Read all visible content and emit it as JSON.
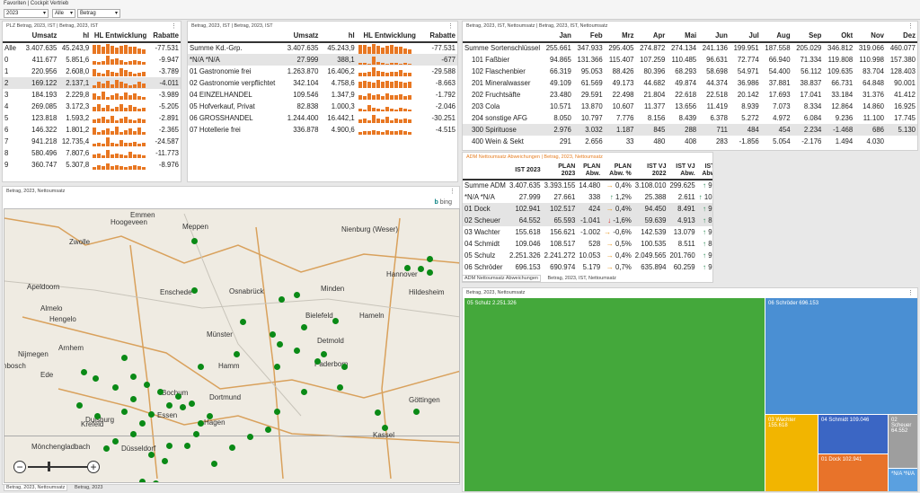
{
  "topbar": {
    "breadcrumb": "Favoriten | Cockpit Vertrieb",
    "filter_year": "2023",
    "filter_all": "Alle",
    "filter_measure": "Betrag"
  },
  "plz": {
    "title": "PLZ Betrag, 2023, IST | Betrag, 2023, IST",
    "headers": [
      "Umsatz",
      "hl",
      "HL Entwicklung",
      "Rabatte"
    ],
    "rows": [
      {
        "label": "Alle",
        "umsatz": "3.407.635",
        "hl": "45.243,9",
        "rabatte": "-77.531",
        "bars": [
          90,
          85,
          70,
          95,
          80,
          60,
          75,
          88,
          65,
          72,
          50,
          40
        ]
      },
      {
        "label": "0",
        "umsatz": "411.677",
        "hl": "5.851,6",
        "rabatte": "-9.947",
        "bars": [
          40,
          30,
          35,
          90,
          55,
          60,
          45,
          30,
          40,
          50,
          35,
          30
        ]
      },
      {
        "label": "1",
        "umsatz": "220.956",
        "hl": "2.608,0",
        "rabatte": "-3.789",
        "bars": [
          70,
          40,
          30,
          60,
          50,
          40,
          80,
          60,
          45,
          30,
          40,
          50
        ]
      },
      {
        "label": "2",
        "umsatz": "169.122",
        "hl": "2.137,1",
        "rabatte": "-4.011",
        "bars": [
          30,
          60,
          50,
          70,
          40,
          80,
          60,
          50,
          30,
          40,
          60,
          50
        ]
      },
      {
        "label": "3",
        "umsatz": "184.193",
        "hl": "2.229,8",
        "rabatte": "-3.989",
        "bars": [
          60,
          40,
          80,
          30,
          50,
          60,
          40,
          70,
          50,
          60,
          40,
          30
        ]
      },
      {
        "label": "4",
        "umsatz": "269.085",
        "hl": "3.172,3",
        "rabatte": "-5.205",
        "bars": [
          50,
          70,
          40,
          60,
          30,
          50,
          70,
          40,
          60,
          50,
          30,
          40
        ]
      },
      {
        "label": "5",
        "umsatz": "123.818",
        "hl": "1.593,2",
        "rabatte": "-2.891",
        "bars": [
          40,
          50,
          60,
          40,
          70,
          30,
          50,
          60,
          40,
          30,
          50,
          40
        ]
      },
      {
        "label": "6",
        "umsatz": "146.322",
        "hl": "1.801,2",
        "rabatte": "-2.365",
        "bars": [
          70,
          30,
          50,
          60,
          40,
          80,
          30,
          50,
          60,
          40,
          70,
          30
        ]
      },
      {
        "label": "7",
        "umsatz": "941.218",
        "hl": "12.735,4",
        "rabatte": "-24.587",
        "bars": [
          30,
          40,
          30,
          90,
          40,
          30,
          60,
          35,
          40,
          45,
          30,
          40
        ]
      },
      {
        "label": "8",
        "umsatz": "580.496",
        "hl": "7.807,6",
        "rabatte": "-11.773",
        "bars": [
          40,
          50,
          30,
          80,
          40,
          50,
          40,
          30,
          60,
          40,
          40,
          30
        ]
      },
      {
        "label": "9",
        "umsatz": "360.747",
        "hl": "5.307,8",
        "rabatte": "-8.976",
        "bars": [
          30,
          50,
          40,
          60,
          40,
          50,
          40,
          30,
          40,
          50,
          40,
          30
        ]
      }
    ]
  },
  "kd": {
    "title": "Betrag, 2023, IST | Betrag, 2023, IST",
    "headers": [
      "Umsatz",
      "hl",
      "HL Entwicklung",
      "Rabatte"
    ],
    "rows": [
      {
        "label": "Summe Kd.-Grp.",
        "umsatz": "3.407.635",
        "hl": "45.243,9",
        "rabatte": "-77.531",
        "bars": [
          90,
          85,
          70,
          95,
          80,
          60,
          75,
          88,
          65,
          72,
          50,
          40
        ]
      },
      {
        "label": "*N/A *N/A",
        "umsatz": "27.999",
        "hl": "388,1",
        "rabatte": "-677",
        "bars": [
          20,
          15,
          10,
          80,
          25,
          15,
          10,
          20,
          15,
          10,
          15,
          10
        ],
        "hl_row": true
      },
      {
        "label": "01 Gastronomie frei",
        "umsatz": "1.263.870",
        "hl": "16.406,2",
        "rabatte": "-29.588",
        "bars": [
          40,
          35,
          50,
          90,
          55,
          45,
          40,
          50,
          45,
          60,
          40,
          35
        ]
      },
      {
        "label": "02 Gastronomie verpflichtet",
        "umsatz": "342.104",
        "hl": "4.758,6",
        "rabatte": "-8.663",
        "bars": [
          60,
          70,
          65,
          55,
          80,
          60,
          70,
          65,
          75,
          60,
          55,
          60
        ]
      },
      {
        "label": "04 EINZELHANDEL",
        "umsatz": "109.546",
        "hl": "1.347,9",
        "rabatte": "-1.792",
        "bars": [
          50,
          40,
          60,
          45,
          55,
          40,
          60,
          50,
          45,
          55,
          40,
          50
        ]
      },
      {
        "label": "05 Hofverkauf, Privat",
        "umsatz": "82.838",
        "hl": "1.000,3",
        "rabatte": "-2.046",
        "bars": [
          30,
          20,
          60,
          40,
          30,
          20,
          50,
          30,
          20,
          40,
          30,
          20
        ]
      },
      {
        "label": "06 GROSSHANDEL",
        "umsatz": "1.244.400",
        "hl": "16.442,1",
        "rabatte": "-30.251",
        "bars": [
          40,
          50,
          30,
          80,
          50,
          40,
          60,
          30,
          50,
          40,
          50,
          40
        ]
      },
      {
        "label": "07 Hotellerie frei",
        "umsatz": "336.878",
        "hl": "4.900,6",
        "rabatte": "-4.515",
        "bars": [
          30,
          40,
          35,
          50,
          40,
          30,
          45,
          35,
          40,
          50,
          35,
          30
        ]
      }
    ]
  },
  "sorten": {
    "title": "Betrag, 2023, IST, Nettoumsatz | Betrag, 2023, IST, Nettoumsatz",
    "months": [
      "Jan",
      "Feb",
      "Mrz",
      "Apr",
      "Mai",
      "Jun",
      "Jul",
      "Aug",
      "Sep",
      "Okt",
      "Nov",
      "Dez"
    ],
    "rows": [
      {
        "label": "Summe Sortenschlüssel",
        "vals": [
          "255.661",
          "347.933",
          "295.405",
          "274.872",
          "274.134",
          "241.136",
          "199.951",
          "187.558",
          "205.029",
          "346.812",
          "319.066",
          "460.077"
        ]
      },
      {
        "label": "101 Faßbier",
        "vals": [
          "94.865",
          "131.366",
          "115.407",
          "107.259",
          "110.485",
          "96.631",
          "72.774",
          "66.940",
          "71.334",
          "119.808",
          "110.998",
          "157.380"
        ]
      },
      {
        "label": "102 Flaschenbier",
        "vals": [
          "66.319",
          "95.053",
          "88.426",
          "80.396",
          "68.293",
          "58.698",
          "54.971",
          "54.400",
          "56.112",
          "109.635",
          "83.704",
          "128.403"
        ]
      },
      {
        "label": "201 Mineralwasser",
        "vals": [
          "49.109",
          "61.569",
          "49.173",
          "44.682",
          "49.874",
          "44.374",
          "36.986",
          "37.881",
          "38.837",
          "66.731",
          "64.848",
          "90.001"
        ]
      },
      {
        "label": "202 Fruchtsäfte",
        "vals": [
          "23.480",
          "29.591",
          "22.498",
          "21.804",
          "22.618",
          "22.518",
          "20.142",
          "17.693",
          "17.041",
          "33.184",
          "31.376",
          "41.412"
        ]
      },
      {
        "label": "203 Cola",
        "vals": [
          "10.571",
          "13.870",
          "10.607",
          "11.377",
          "13.656",
          "11.419",
          "8.939",
          "7.073",
          "8.334",
          "12.864",
          "14.860",
          "16.925"
        ]
      },
      {
        "label": "204 sonstige AFG",
        "vals": [
          "8.050",
          "10.797",
          "7.776",
          "8.156",
          "8.439",
          "6.378",
          "5.272",
          "4.972",
          "6.084",
          "9.236",
          "11.100",
          "17.745"
        ]
      },
      {
        "label": "300 Spirituose",
        "vals": [
          "2.976",
          "3.032",
          "1.187",
          "845",
          "288",
          "711",
          "484",
          "454",
          "2.234",
          "-1.468",
          "686",
          "5.130"
        ],
        "hl_row": true
      },
      {
        "label": "400 Wein & Sekt",
        "vals": [
          "291",
          "2.656",
          "33",
          "480",
          "408",
          "283",
          "-1.856",
          "5.054",
          "-2.176",
          "1.494",
          "4.030",
          ""
        ]
      }
    ]
  },
  "adm": {
    "title": "ADM Nettoumsatz Abweichungen | Betrag, 2023, Nettoumsatz",
    "headers": [
      "IST 2023",
      "PLAN 2023",
      "PLAN Abw.",
      "PLAN Abw. %",
      "IST VJ 2022",
      "IST VJ Abw.",
      "IST VJ Abw. %"
    ],
    "rows": [
      {
        "label": "Summe ADM",
        "ist": "3.407.635",
        "plan": "3.393.155",
        "abw": "14.480",
        "ar": "right",
        "pct": "0,4%",
        "vj": "3.108.010",
        "vjabw": "299.625",
        "vr": "up",
        "vjpct": "9,6%"
      },
      {
        "label": "*N/A *N/A",
        "ist": "27.999",
        "plan": "27.661",
        "abw": "338",
        "ar": "up",
        "pct": "1,2%",
        "vj": "25.388",
        "vjabw": "2.611",
        "vr": "up",
        "vjpct": "10,3%"
      },
      {
        "label": "01 Dock",
        "ist": "102.941",
        "plan": "102.517",
        "abw": "424",
        "ar": "right",
        "pct": "0,4%",
        "vj": "94.450",
        "vjabw": "8.491",
        "vr": "up",
        "vjpct": "9,0%",
        "hl_row": true
      },
      {
        "label": "02 Scheuer",
        "ist": "64.552",
        "plan": "65.593",
        "abw": "-1.041",
        "ar": "down",
        "pct": "-1,6%",
        "vj": "59.639",
        "vjabw": "4.913",
        "vr": "up",
        "vjpct": "8,2%",
        "hl_row": true
      },
      {
        "label": "03 Wachter",
        "ist": "155.618",
        "plan": "156.621",
        "abw": "-1.002",
        "ar": "right",
        "pct": "-0,6%",
        "vj": "142.539",
        "vjabw": "13.079",
        "vr": "up",
        "vjpct": "9,2%"
      },
      {
        "label": "04 Schmidt",
        "ist": "109.046",
        "plan": "108.517",
        "abw": "528",
        "ar": "right",
        "pct": "0,5%",
        "vj": "100.535",
        "vjabw": "8.511",
        "vr": "up",
        "vjpct": "8,5%"
      },
      {
        "label": "05 Schulz",
        "ist": "2.251.326",
        "plan": "2.241.272",
        "abw": "10.053",
        "ar": "right",
        "pct": "0,4%",
        "vj": "2.049.565",
        "vjabw": "201.760",
        "vr": "up",
        "vjpct": "9,8%"
      },
      {
        "label": "06 Schröder",
        "ist": "696.153",
        "plan": "690.974",
        "abw": "5.179",
        "ar": "right",
        "pct": "0,7%",
        "vj": "635.894",
        "vjabw": "60.259",
        "vr": "up",
        "vjpct": "9,5%"
      }
    ]
  },
  "adm_tabs": [
    "ADM Nettoumsatz Abweichungen",
    "Betrag, 2023, IST, Nettoumsatz"
  ],
  "map": {
    "title": "Betrag, 2023, Nettoumsatz",
    "bing": "bing",
    "cities": [
      "Emmen",
      "Meppen",
      "Hoogeveen",
      "Nienburg (Weser)",
      "Zwolle",
      "Hannover",
      "Apeldoorn",
      "Enschede",
      "Osnabrück",
      "Minden",
      "Hildesheim",
      "Almelo",
      "Hengelo",
      "Bielefeld",
      "Hameln",
      "Münster",
      "Detmold",
      "Nijmegen",
      "Hamm",
      "Paderborn",
      "Bochum",
      "Dortmund",
      "Duisburg",
      "Essen",
      "Krefeld",
      "Hagen",
      "Göttingen",
      "Mönchengladbach",
      "Düsseldorf",
      "Kassel",
      "Arnhem",
      "Ede",
      "nbosch"
    ],
    "tabs": [
      "Betrag, 2023, Nettoumsatz",
      "Betrag, 2023"
    ]
  },
  "treemap": {
    "title": "Betrag, 2023, Nettoumsatz",
    "items": [
      {
        "label": "05 Schulz 2.251.326",
        "color": "#44a83b"
      },
      {
        "label": "06 Schröder 696.153",
        "color": "#4a8fd3"
      },
      {
        "label": "03 Wachter 155.618",
        "color": "#f2b500"
      },
      {
        "label": "04 Schmidt 109.046",
        "color": "#3b66c4"
      },
      {
        "label": "02 Scheuer 64.552",
        "color": "#9e9e9e"
      },
      {
        "label": "01 Dock 102.941",
        "color": "#e8732a"
      },
      {
        "label": "*N/A *N/A",
        "color": "#5aa0e0"
      }
    ]
  }
}
